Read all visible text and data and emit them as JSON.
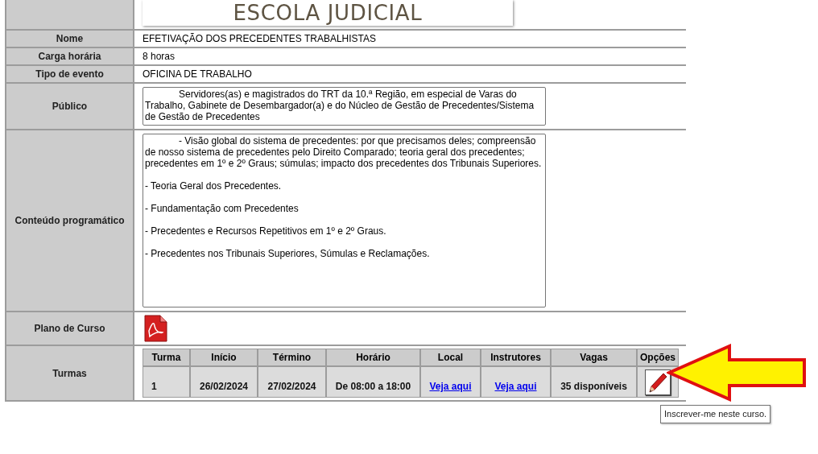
{
  "banner": {
    "title": "ESCOLA JUDICIAL"
  },
  "fields": [
    {
      "kind": "text",
      "label": "Nome",
      "value": "EFETIVAÇÃO DOS PRECEDENTES TRABALHISTAS"
    },
    {
      "kind": "text",
      "label": "Carga horária",
      "value": "8 horas"
    },
    {
      "kind": "text",
      "label": "Tipo de evento",
      "value": "OFICINA DE TRABALHO"
    },
    {
      "kind": "textarea",
      "label": "Público",
      "value": "Servidores(as) e magistrados do TRT da 10.ª Região, em especial de Varas do Trabalho, Gabinete de Desembargador(a) e do Núcleo de Gestão de Precedentes/Sistema de Gestão de Precedentes"
    },
    {
      "kind": "textarea",
      "label": "Conteúdo programático",
      "value": "- Visão global do sistema de precedentes: por que precisamos deles; compreensão de nosso sistema de precedentes pelo Direito Comparado; teoria geral dos precedentes; precedentes em 1º e 2º Graus; súmulas; impacto dos precedentes dos Tribunais Superiores.\n\n- Teoria Geral dos Precedentes.\n\n- Fundamentação com Precedentes\n\n- Precedentes e Recursos Repetitivos em 1º e 2º Graus.\n\n- Precedentes nos Tribunais Superiores, Súmulas e Reclamações."
    },
    {
      "kind": "pdf",
      "label": "Plano de Curso"
    }
  ],
  "turmas": {
    "label": "Turmas",
    "columns": [
      "Turma",
      "Início",
      "Término",
      "Horário",
      "Local",
      "Instrutores",
      "Vagas",
      "Opções"
    ],
    "rows": [
      {
        "turma": "1",
        "inicio": "26/02/2024",
        "termino": "27/02/2024",
        "horario": "De 08:00 a 18:00",
        "local": "Veja aqui",
        "instrutores": "Veja aqui",
        "vagas": "35 disponíveis"
      }
    ]
  },
  "tooltip": "Inscrever-me neste curso."
}
